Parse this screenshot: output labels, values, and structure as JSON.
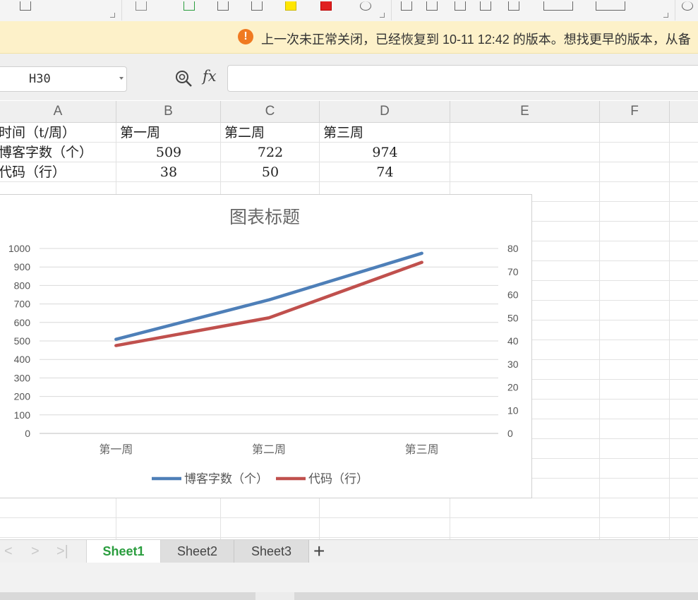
{
  "notification": {
    "icon": "warning-icon",
    "message": "上一次未正常关闭，已经恢复到 10-11 12:42 的版本。想找更早的版本，从备"
  },
  "formula_bar": {
    "cell_ref": "H30",
    "fx_label": "fx",
    "value": ""
  },
  "columns": [
    "A",
    "B",
    "C",
    "D",
    "E",
    "F"
  ],
  "cells": {
    "a1": "时间（t/周）",
    "b1": "第一周",
    "c1": "第二周",
    "d1": "第三周",
    "a2": "博客字数（个）",
    "b2": "509",
    "c2": "722",
    "d2": "974",
    "a3": "代码（行）",
    "b3": "38",
    "c3": "50",
    "d3": "74"
  },
  "chart_data": {
    "type": "line",
    "title": "图表标题",
    "categories": [
      "第一周",
      "第二周",
      "第三周"
    ],
    "series": [
      {
        "name": "博客字数（个）",
        "values": [
          509,
          722,
          974
        ],
        "axis": "left",
        "color": "#4e7fb8"
      },
      {
        "name": "代码（行）",
        "values": [
          38,
          50,
          74
        ],
        "axis": "right",
        "color": "#c0504d"
      }
    ],
    "ylim": [
      0,
      1000
    ],
    "y_ticks": [
      "0",
      "100",
      "200",
      "300",
      "400",
      "500",
      "600",
      "700",
      "800",
      "900",
      "1000"
    ],
    "y2lim": [
      0,
      80
    ],
    "y2_ticks": [
      "0",
      "10",
      "20",
      "30",
      "40",
      "50",
      "60",
      "70",
      "80"
    ],
    "grid": true,
    "legend": "bottom"
  },
  "sheet_tabs": {
    "nav_prev": "<",
    "nav_next": ">",
    "nav_last": ">|",
    "tabs": [
      "Sheet1",
      "Sheet2",
      "Sheet3"
    ],
    "active": "Sheet1",
    "add": "+"
  }
}
